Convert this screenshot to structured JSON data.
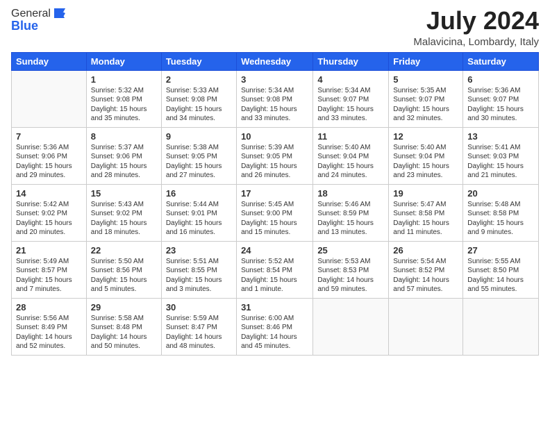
{
  "logo": {
    "general": "General",
    "blue": "Blue"
  },
  "title": "July 2024",
  "subtitle": "Malavicina, Lombardy, Italy",
  "days_of_week": [
    "Sunday",
    "Monday",
    "Tuesday",
    "Wednesday",
    "Thursday",
    "Friday",
    "Saturday"
  ],
  "weeks": [
    [
      {
        "day": "",
        "info": ""
      },
      {
        "day": "1",
        "info": "Sunrise: 5:32 AM\nSunset: 9:08 PM\nDaylight: 15 hours\nand 35 minutes."
      },
      {
        "day": "2",
        "info": "Sunrise: 5:33 AM\nSunset: 9:08 PM\nDaylight: 15 hours\nand 34 minutes."
      },
      {
        "day": "3",
        "info": "Sunrise: 5:34 AM\nSunset: 9:08 PM\nDaylight: 15 hours\nand 33 minutes."
      },
      {
        "day": "4",
        "info": "Sunrise: 5:34 AM\nSunset: 9:07 PM\nDaylight: 15 hours\nand 33 minutes."
      },
      {
        "day": "5",
        "info": "Sunrise: 5:35 AM\nSunset: 9:07 PM\nDaylight: 15 hours\nand 32 minutes."
      },
      {
        "day": "6",
        "info": "Sunrise: 5:36 AM\nSunset: 9:07 PM\nDaylight: 15 hours\nand 30 minutes."
      }
    ],
    [
      {
        "day": "7",
        "info": "Sunrise: 5:36 AM\nSunset: 9:06 PM\nDaylight: 15 hours\nand 29 minutes."
      },
      {
        "day": "8",
        "info": "Sunrise: 5:37 AM\nSunset: 9:06 PM\nDaylight: 15 hours\nand 28 minutes."
      },
      {
        "day": "9",
        "info": "Sunrise: 5:38 AM\nSunset: 9:05 PM\nDaylight: 15 hours\nand 27 minutes."
      },
      {
        "day": "10",
        "info": "Sunrise: 5:39 AM\nSunset: 9:05 PM\nDaylight: 15 hours\nand 26 minutes."
      },
      {
        "day": "11",
        "info": "Sunrise: 5:40 AM\nSunset: 9:04 PM\nDaylight: 15 hours\nand 24 minutes."
      },
      {
        "day": "12",
        "info": "Sunrise: 5:40 AM\nSunset: 9:04 PM\nDaylight: 15 hours\nand 23 minutes."
      },
      {
        "day": "13",
        "info": "Sunrise: 5:41 AM\nSunset: 9:03 PM\nDaylight: 15 hours\nand 21 minutes."
      }
    ],
    [
      {
        "day": "14",
        "info": "Sunrise: 5:42 AM\nSunset: 9:02 PM\nDaylight: 15 hours\nand 20 minutes."
      },
      {
        "day": "15",
        "info": "Sunrise: 5:43 AM\nSunset: 9:02 PM\nDaylight: 15 hours\nand 18 minutes."
      },
      {
        "day": "16",
        "info": "Sunrise: 5:44 AM\nSunset: 9:01 PM\nDaylight: 15 hours\nand 16 minutes."
      },
      {
        "day": "17",
        "info": "Sunrise: 5:45 AM\nSunset: 9:00 PM\nDaylight: 15 hours\nand 15 minutes."
      },
      {
        "day": "18",
        "info": "Sunrise: 5:46 AM\nSunset: 8:59 PM\nDaylight: 15 hours\nand 13 minutes."
      },
      {
        "day": "19",
        "info": "Sunrise: 5:47 AM\nSunset: 8:58 PM\nDaylight: 15 hours\nand 11 minutes."
      },
      {
        "day": "20",
        "info": "Sunrise: 5:48 AM\nSunset: 8:58 PM\nDaylight: 15 hours\nand 9 minutes."
      }
    ],
    [
      {
        "day": "21",
        "info": "Sunrise: 5:49 AM\nSunset: 8:57 PM\nDaylight: 15 hours\nand 7 minutes."
      },
      {
        "day": "22",
        "info": "Sunrise: 5:50 AM\nSunset: 8:56 PM\nDaylight: 15 hours\nand 5 minutes."
      },
      {
        "day": "23",
        "info": "Sunrise: 5:51 AM\nSunset: 8:55 PM\nDaylight: 15 hours\nand 3 minutes."
      },
      {
        "day": "24",
        "info": "Sunrise: 5:52 AM\nSunset: 8:54 PM\nDaylight: 15 hours\nand 1 minute."
      },
      {
        "day": "25",
        "info": "Sunrise: 5:53 AM\nSunset: 8:53 PM\nDaylight: 14 hours\nand 59 minutes."
      },
      {
        "day": "26",
        "info": "Sunrise: 5:54 AM\nSunset: 8:52 PM\nDaylight: 14 hours\nand 57 minutes."
      },
      {
        "day": "27",
        "info": "Sunrise: 5:55 AM\nSunset: 8:50 PM\nDaylight: 14 hours\nand 55 minutes."
      }
    ],
    [
      {
        "day": "28",
        "info": "Sunrise: 5:56 AM\nSunset: 8:49 PM\nDaylight: 14 hours\nand 52 minutes."
      },
      {
        "day": "29",
        "info": "Sunrise: 5:58 AM\nSunset: 8:48 PM\nDaylight: 14 hours\nand 50 minutes."
      },
      {
        "day": "30",
        "info": "Sunrise: 5:59 AM\nSunset: 8:47 PM\nDaylight: 14 hours\nand 48 minutes."
      },
      {
        "day": "31",
        "info": "Sunrise: 6:00 AM\nSunset: 8:46 PM\nDaylight: 14 hours\nand 45 minutes."
      },
      {
        "day": "",
        "info": ""
      },
      {
        "day": "",
        "info": ""
      },
      {
        "day": "",
        "info": ""
      }
    ]
  ]
}
